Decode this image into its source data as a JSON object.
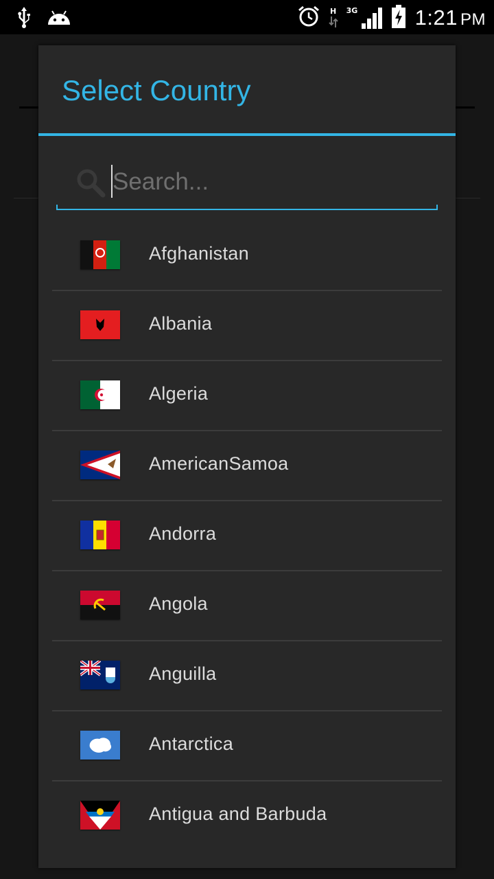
{
  "status_bar": {
    "time": "1:21",
    "ampm": "PM",
    "network_h": "H",
    "network_3g": "3G",
    "icons": [
      "usb-icon",
      "android-icon",
      "alarm-icon",
      "data-transfer-icon",
      "signal-icon",
      "battery-charging-icon"
    ]
  },
  "dialog": {
    "title": "Select Country",
    "search_placeholder": "Search...",
    "accent_color": "#33b5e5"
  },
  "countries": [
    {
      "name": "Afghanistan",
      "flag": "flag-afghanistan"
    },
    {
      "name": "Albania",
      "flag": "flag-albania"
    },
    {
      "name": "Algeria",
      "flag": "flag-algeria"
    },
    {
      "name": "AmericanSamoa",
      "flag": "flag-american-samoa"
    },
    {
      "name": "Andorra",
      "flag": "flag-andorra"
    },
    {
      "name": "Angola",
      "flag": "flag-angola"
    },
    {
      "name": "Anguilla",
      "flag": "flag-anguilla"
    },
    {
      "name": "Antarctica",
      "flag": "flag-antarctica"
    },
    {
      "name": "Antigua and Barbuda",
      "flag": "flag-antigua-and-barbuda"
    }
  ]
}
